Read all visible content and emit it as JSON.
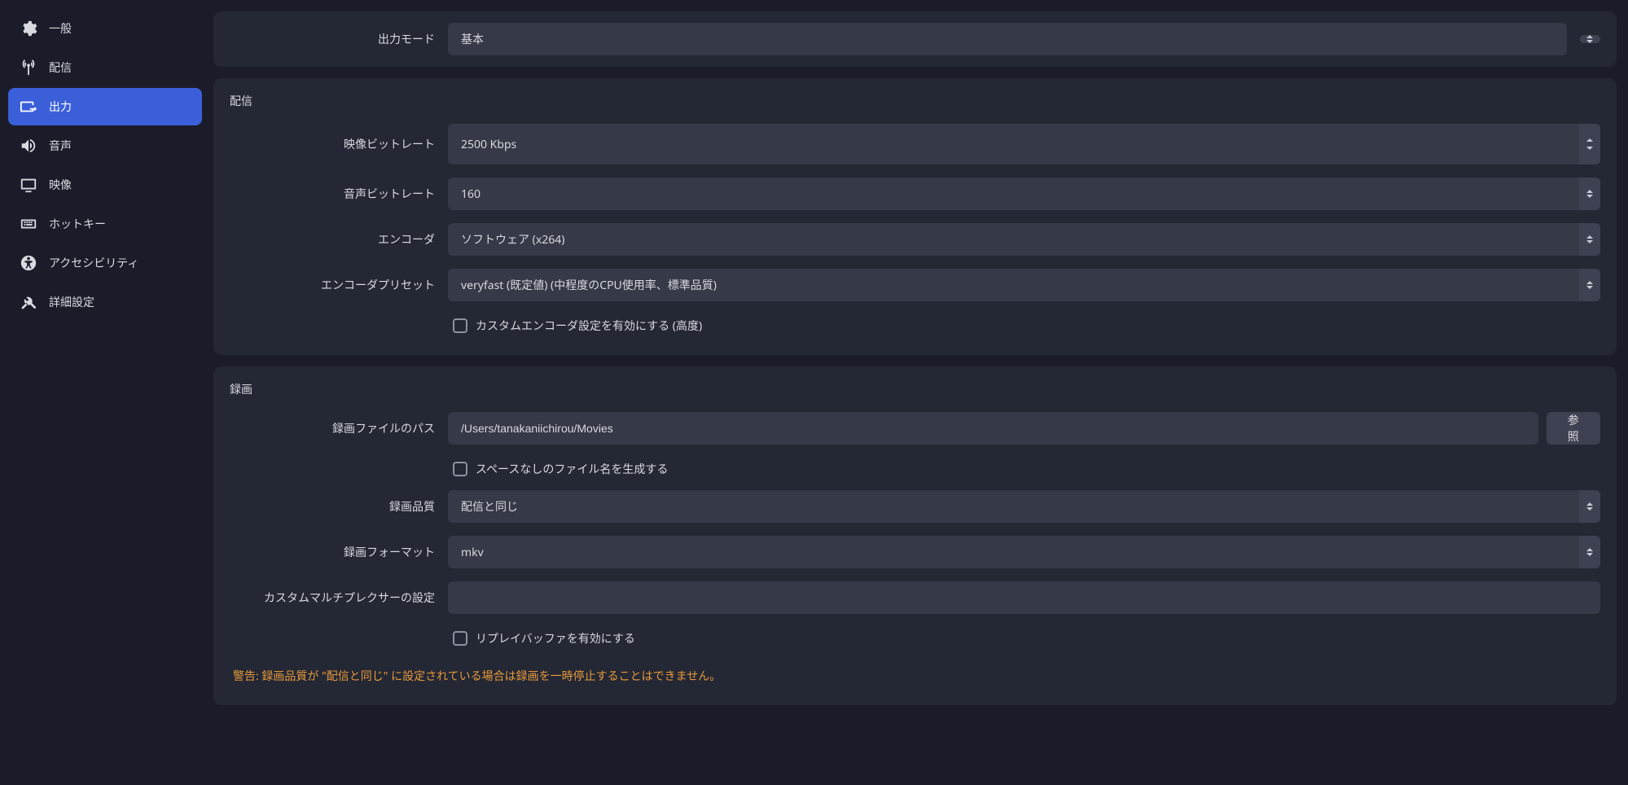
{
  "sidebar": {
    "items": [
      {
        "label": "一般"
      },
      {
        "label": "配信"
      },
      {
        "label": "出力"
      },
      {
        "label": "音声"
      },
      {
        "label": "映像"
      },
      {
        "label": "ホットキー"
      },
      {
        "label": "アクセシビリティ"
      },
      {
        "label": "詳細設定"
      }
    ]
  },
  "top": {
    "output_mode_label": "出力モード",
    "output_mode_value": "基本"
  },
  "stream": {
    "title": "配信",
    "video_bitrate_label": "映像ビットレート",
    "video_bitrate_value": "2500 Kbps",
    "audio_bitrate_label": "音声ビットレート",
    "audio_bitrate_value": "160",
    "encoder_label": "エンコーダ",
    "encoder_value": "ソフトウェア (x264)",
    "preset_label": "エンコーダプリセット",
    "preset_value": "veryfast (既定値) (中程度のCPU使用率、標準品質)",
    "custom_encoder_checkbox": "カスタムエンコーダ設定を有効にする (高度)"
  },
  "record": {
    "title": "録画",
    "path_label": "録画ファイルのパス",
    "path_value": "/Users/tanakaniichirou/Movies",
    "browse_button": "参照",
    "nospace_checkbox": "スペースなしのファイル名を生成する",
    "quality_label": "録画品質",
    "quality_value": "配信と同じ",
    "format_label": "録画フォーマット",
    "format_value": "mkv",
    "muxer_label": "カスタムマルチプレクサーの設定",
    "muxer_value": "",
    "replay_checkbox": "リプレイバッファを有効にする"
  },
  "warning": "警告: 録画品質が \"配信と同じ\" に設定されている場合は録画を一時停止することはできません。"
}
